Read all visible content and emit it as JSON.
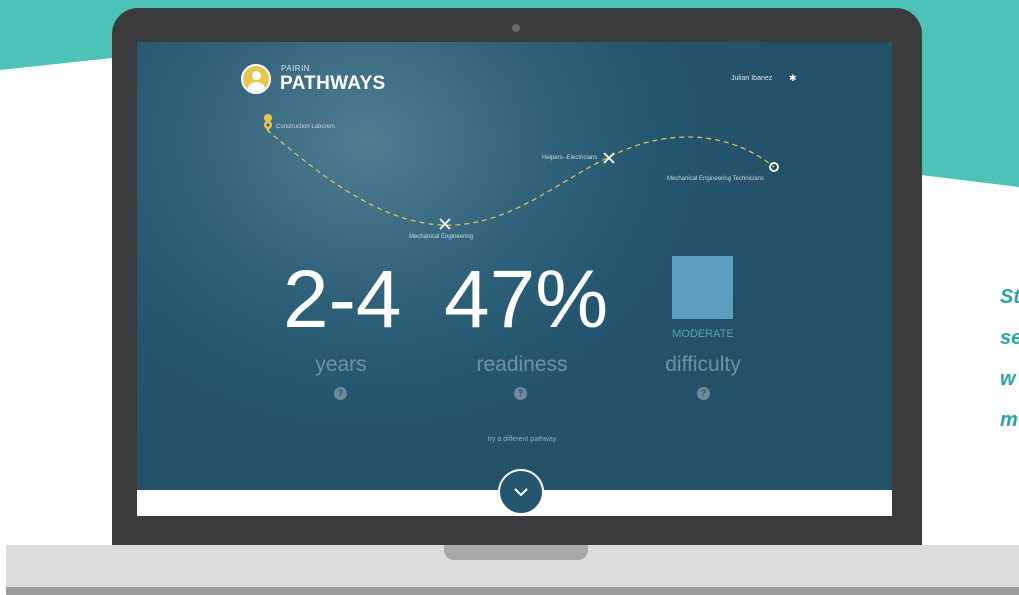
{
  "app": {
    "brand_small": "PAIRIN",
    "brand_big": "PATHWAYS",
    "user_name": "Julian Ibanez"
  },
  "pathway": {
    "start": "Construction Laborers",
    "step1": "Mechanical Engineering",
    "step2": "Helpers--Electricians",
    "goal": "Mechanical Engineering Technicians"
  },
  "stats": {
    "years_value": "2-4",
    "years_label": "years",
    "readiness_value": "47%",
    "readiness_label": "readiness",
    "difficulty_level": "MODERATE",
    "difficulty_label": "difficulty",
    "help_glyph": "?"
  },
  "actions": {
    "try_different": "try a different pathway"
  },
  "side_text": [
    "St",
    "se",
    "w",
    "m"
  ],
  "colors": {
    "teal": "#4cc3b6",
    "screen_bg": "#24566f",
    "accent_yellow": "#e8c64d",
    "difficulty_blue": "#5b9ebd"
  }
}
